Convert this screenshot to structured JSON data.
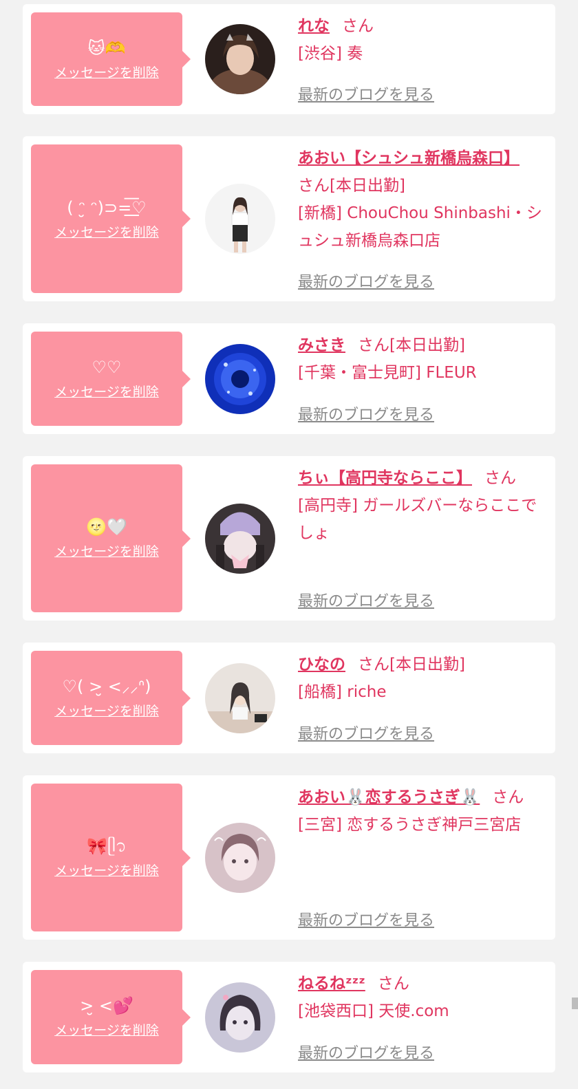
{
  "theme": {
    "accent": "#e0355f",
    "bubble": "#fc94a1",
    "link_gray": "#8a8a8a",
    "background": "#f2f2f2"
  },
  "labels": {
    "delete": "メッセージを削除",
    "blog": "最新のブログを見る",
    "san": "さん"
  },
  "items": [
    {
      "message": "🐱🫶",
      "name": "れな",
      "status": "",
      "area": "[渋谷] 奏",
      "avatar_icon": "portrait-photo",
      "avatar_colors": [
        "#6b4a3a",
        "#2a1f1c",
        "#e8c9b5"
      ]
    },
    {
      "message": "( ᵔ̮ ᵔ)⊃=͟͟͞♡",
      "name": "あおい【シュシュ新橋烏森口】",
      "status": "[本日出勤]",
      "area": "[新橋] ChouChou Shinbashi・シュシュ新橋烏森口店",
      "avatar_icon": "portrait-photo",
      "avatar_colors": [
        "#f4f4f4",
        "#e9e6e6",
        "#2b2b2b"
      ]
    },
    {
      "message": "♡♡",
      "name": "みさき",
      "status": "[本日出勤]",
      "area": "[千葉・富士見町] FLEUR",
      "avatar_icon": "portrait-photo",
      "avatar_colors": [
        "#0f2fb8",
        "#061a6e",
        "#4f7bff"
      ]
    },
    {
      "message": "🌝🤍",
      "name": "ちぃ【高円寺ならここ】",
      "status": "",
      "area": "[高円寺] ガールズバーならここでしょ",
      "avatar_icon": "portrait-photo",
      "avatar_colors": [
        "#b7a7d8",
        "#3a3335",
        "#f1e4e6"
      ]
    },
    {
      "message": "♡( >̮ <⸝⸝ᐢ)",
      "name": "ひなの",
      "status": "[本日出勤]",
      "area": "[船橋] riche",
      "avatar_icon": "portrait-photo",
      "avatar_colors": [
        "#e9e3de",
        "#3d3636",
        "#d9c9bd"
      ]
    },
    {
      "message": "🎀ᥫ᭡",
      "name": "あおい🐰恋するうさぎ🐰",
      "status": "",
      "area": "[三宮] 恋するうさぎ神戸三宮店",
      "avatar_icon": "portrait-photo",
      "avatar_colors": [
        "#d7c2c8",
        "#8b6a72",
        "#f6e7ea"
      ]
    },
    {
      "message": ">̮ <💕",
      "name": "ねるねᶻᶻᶻ",
      "status": "",
      "area": "[池袋西口] 天使.com",
      "avatar_icon": "portrait-photo",
      "avatar_colors": [
        "#c9c6d8",
        "#3b3340",
        "#ece6ee"
      ]
    }
  ]
}
